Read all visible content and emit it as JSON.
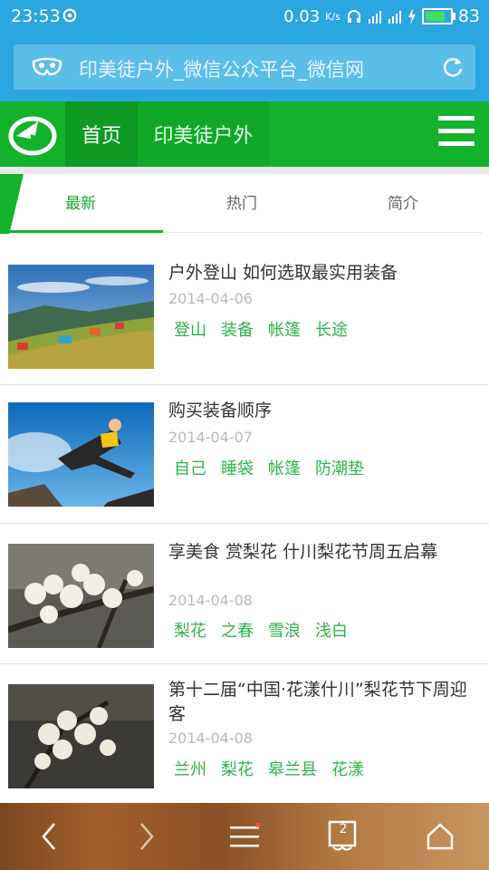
{
  "status_bar": {
    "time": "23:53",
    "net_speed": "0.03",
    "net_unit": "K/s",
    "battery": "83",
    "battery_level": 0.83,
    "battery_color": "#3fe05a"
  },
  "address_bar": {
    "title": "印美徒户外_微信公众平台_微信网"
  },
  "site_nav": {
    "home": "首页",
    "site": "印美徒户外"
  },
  "sub_tabs": {
    "items": [
      "最新",
      "热门",
      "简介"
    ],
    "active": "最新"
  },
  "articles": [
    {
      "title": "户外登山 如何选取最实用装备",
      "date": "2014-04-06",
      "tags": [
        "登山",
        "装备",
        "帐篷",
        "长途"
      ]
    },
    {
      "title": "购买装备顺序",
      "date": "2014-04-07",
      "tags": [
        "自己",
        "睡袋",
        "帐篷",
        "防潮垫"
      ]
    },
    {
      "title": "享美食 赏梨花 什川梨花节周五启幕",
      "date": "2014-04-08",
      "tags": [
        "梨花",
        "之春",
        "雪浪",
        "浅白"
      ]
    },
    {
      "title": "第十二届“中国·花漾什川”梨花节下周迎客",
      "date": "2014-04-08",
      "tags": [
        "兰州",
        "梨花",
        "皋兰县",
        "花漾"
      ]
    }
  ],
  "bottom_bar": {
    "tab_count": "2"
  },
  "colors": {
    "status_blue": "#2aa6e0",
    "brand_green": "#12b32b",
    "tag_green": "#2eb34a"
  },
  "icons": [
    "signal-loop-icon",
    "headphone-icon",
    "wifi-icon",
    "cell-signal-icon",
    "charging-icon",
    "battery-icon",
    "mask-icon",
    "reload-icon",
    "site-logo-icon",
    "menu-icon",
    "back-icon",
    "forward-icon",
    "menu-lines-icon",
    "tabs-icon",
    "home-icon"
  ]
}
